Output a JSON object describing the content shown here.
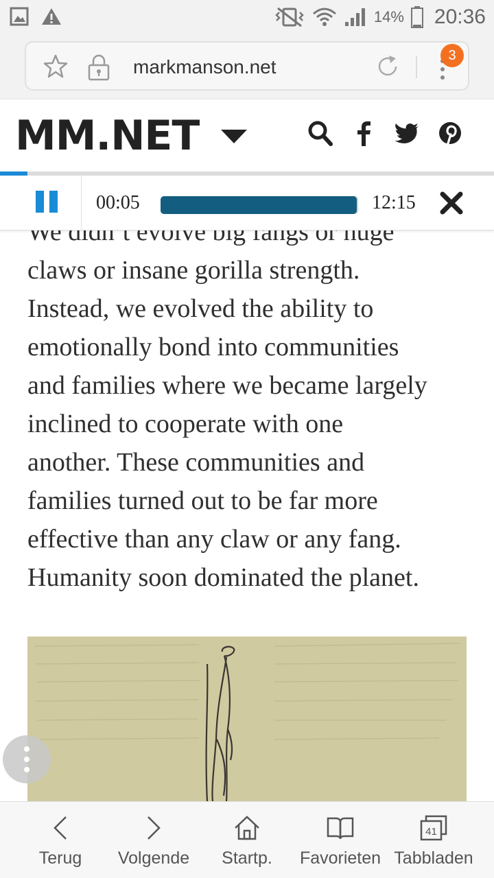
{
  "status_bar": {
    "battery_percent": "14%",
    "time": "20:36",
    "left_icons": [
      "gallery-icon",
      "warning-icon"
    ],
    "right_icons": [
      "vibrate-icon",
      "wifi-icon",
      "signal-icon",
      "battery-icon"
    ]
  },
  "browser": {
    "url": "markmanson.net",
    "tab_badge_count": "3"
  },
  "site_header": {
    "logo": "MM.NET",
    "icons": [
      "search-icon",
      "facebook-icon",
      "twitter-icon",
      "pinterest-icon"
    ],
    "reading_progress": 0.055
  },
  "audio_player": {
    "current_time": "00:05",
    "total_time": "12:15",
    "progress": 0.007
  },
  "article": {
    "lines": [
      "We didn’t evolve big fangs or huge",
      "claws or insane gorilla strength.",
      "Instead, we evolved the ability to",
      "emotionally bond into communities",
      "and families where we became largely",
      "inclined to cooperate with one",
      "another. These communities and",
      "families turned out to be far more",
      "effective than any claw or any fang.",
      "Humanity soon dominated the planet."
    ]
  },
  "bottom_nav": {
    "items": [
      {
        "label": "Terug",
        "icon": "chevron-left-icon"
      },
      {
        "label": "Volgende",
        "icon": "chevron-right-icon"
      },
      {
        "label": "Startp.",
        "icon": "home-icon"
      },
      {
        "label": "Favorieten",
        "icon": "bookmarks-icon"
      },
      {
        "label": "Tabbladen",
        "icon": "tabs-icon"
      }
    ],
    "tabs_count": "41"
  }
}
